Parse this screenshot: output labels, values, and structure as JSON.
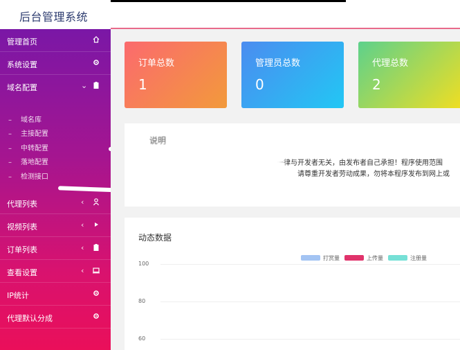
{
  "app": {
    "title": "后台管理系统"
  },
  "sidebar": {
    "items": [
      {
        "label": "管理首页",
        "icon": "home-icon"
      },
      {
        "label": "系统设置",
        "icon": "gear-icon"
      },
      {
        "label": "域名配置",
        "icon": "clipboard-icon",
        "expanded": true
      },
      {
        "label": "代理列表",
        "icon": "user-icon"
      },
      {
        "label": "视频列表",
        "icon": "play-icon"
      },
      {
        "label": "订单列表",
        "icon": "clipboard-icon"
      },
      {
        "label": "查看设置",
        "icon": "monitor-icon"
      },
      {
        "label": "IP统计",
        "icon": "gear-icon"
      },
      {
        "label": "代理默认分成",
        "icon": "gear-icon"
      }
    ],
    "submenu": [
      "域名库",
      "主接配置",
      "中转配置",
      "落地配置",
      "检测接口"
    ],
    "arrow_glyph": "‹",
    "expanded_arrow_glyph": "⌄",
    "dash_glyph": "–",
    "accent_top": "#7a17a6",
    "accent_bottom": "#ea0f5a"
  },
  "stats": [
    {
      "title": "订单总数",
      "value": "1"
    },
    {
      "title": "管理员总数",
      "value": "0"
    },
    {
      "title": "代理总数",
      "value": "2"
    }
  ],
  "notice": {
    "title": "说明",
    "line1": "一律与开发者无关，由发布者自己承担！程序使用范围",
    "line2": "请尊重开发者劳动成果，勿将本程序发布到网上或"
  },
  "chart": {
    "title": "动态数据",
    "legend": [
      {
        "label": "打赏量",
        "color": "#a3c4f3"
      },
      {
        "label": "上传量",
        "color": "#e0336b"
      },
      {
        "label": "注册量",
        "color": "#76e0d6"
      }
    ],
    "y_ticks": [
      "100",
      "80",
      "60"
    ]
  },
  "chart_data": {
    "type": "line",
    "title": "动态数据",
    "series": [
      {
        "name": "打赏量",
        "values": []
      },
      {
        "name": "上传量",
        "values": []
      },
      {
        "name": "注册量",
        "values": []
      }
    ],
    "y_ticks": [
      100,
      80,
      60
    ],
    "grid": true,
    "legend": "top-center"
  }
}
